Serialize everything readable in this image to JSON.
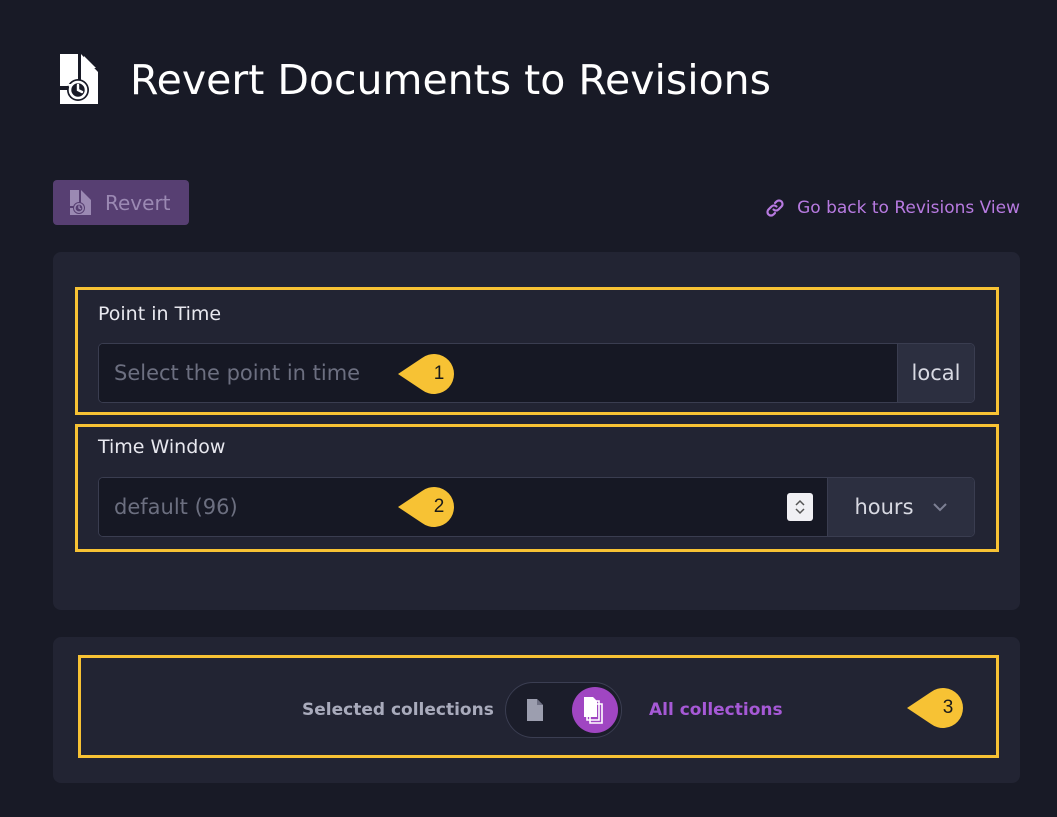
{
  "header": {
    "title": "Revert Documents to Revisions",
    "icon": "revert-revisions-icon"
  },
  "toolbar": {
    "revert_label": "Revert",
    "back_link_label": "Go back to Revisions View"
  },
  "point_in_time": {
    "label": "Point in Time",
    "placeholder": "Select the point in time",
    "value": "",
    "timezone_addon": "local"
  },
  "time_window": {
    "label": "Time Window",
    "placeholder": "default (96)",
    "value": "",
    "unit_selected": "hours"
  },
  "collections": {
    "selected_label": "Selected collections",
    "all_label": "All collections",
    "active_option": "All collections"
  },
  "callouts": [
    "1",
    "2",
    "3"
  ],
  "colors": {
    "background": "#181a26",
    "panel": "#222433",
    "accent": "#a046c2",
    "link": "#b77ae0",
    "highlight": "#f7c234"
  }
}
